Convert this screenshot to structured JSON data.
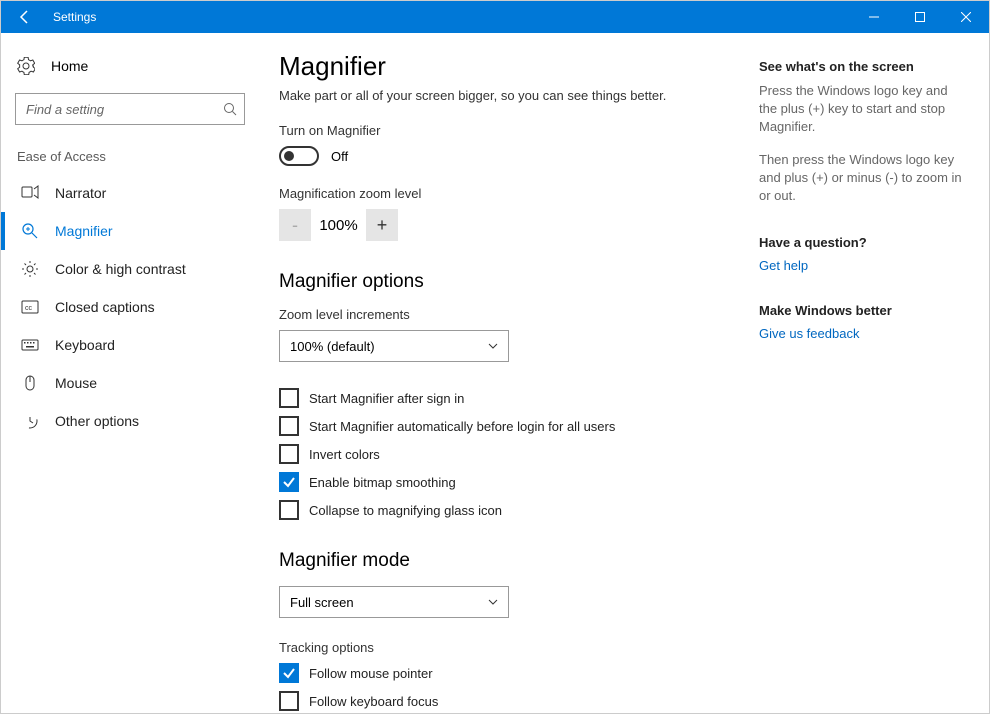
{
  "titlebar": {
    "title": "Settings"
  },
  "sidebar": {
    "home": "Home",
    "search_placeholder": "Find a setting",
    "section": "Ease of Access",
    "items": [
      {
        "label": "Narrator"
      },
      {
        "label": "Magnifier"
      },
      {
        "label": "Color & high contrast"
      },
      {
        "label": "Closed captions"
      },
      {
        "label": "Keyboard"
      },
      {
        "label": "Mouse"
      },
      {
        "label": "Other options"
      }
    ]
  },
  "main": {
    "title": "Magnifier",
    "subtitle": "Make part or all of your screen bigger, so you can see things better.",
    "turn_on_label": "Turn on Magnifier",
    "toggle_state": "Off",
    "zoom_label": "Magnification zoom level",
    "zoom_minus": "-",
    "zoom_value": "100%",
    "zoom_plus": "+",
    "options_header": "Magnifier options",
    "zoom_increments_label": "Zoom level increments",
    "zoom_increments_value": "100% (default)",
    "checkboxes": [
      {
        "label": "Start Magnifier after sign in",
        "checked": false
      },
      {
        "label": "Start Magnifier automatically before login for all users",
        "checked": false
      },
      {
        "label": "Invert colors",
        "checked": false
      },
      {
        "label": "Enable bitmap smoothing",
        "checked": true
      },
      {
        "label": "Collapse to magnifying glass icon",
        "checked": false
      }
    ],
    "mode_header": "Magnifier mode",
    "mode_value": "Full screen",
    "tracking_header": "Tracking options",
    "tracking": [
      {
        "label": "Follow mouse pointer",
        "checked": true
      },
      {
        "label": "Follow keyboard focus",
        "checked": false
      }
    ]
  },
  "aside": {
    "see_header": "See what's on the screen",
    "see_p1": "Press the Windows logo key and the plus (+) key to start and stop Magnifier.",
    "see_p2": "Then press the Windows logo key and plus (+) or minus (-) to zoom in or out.",
    "q_header": "Have a question?",
    "q_link": "Get help",
    "fb_header": "Make Windows better",
    "fb_link": "Give us feedback"
  }
}
